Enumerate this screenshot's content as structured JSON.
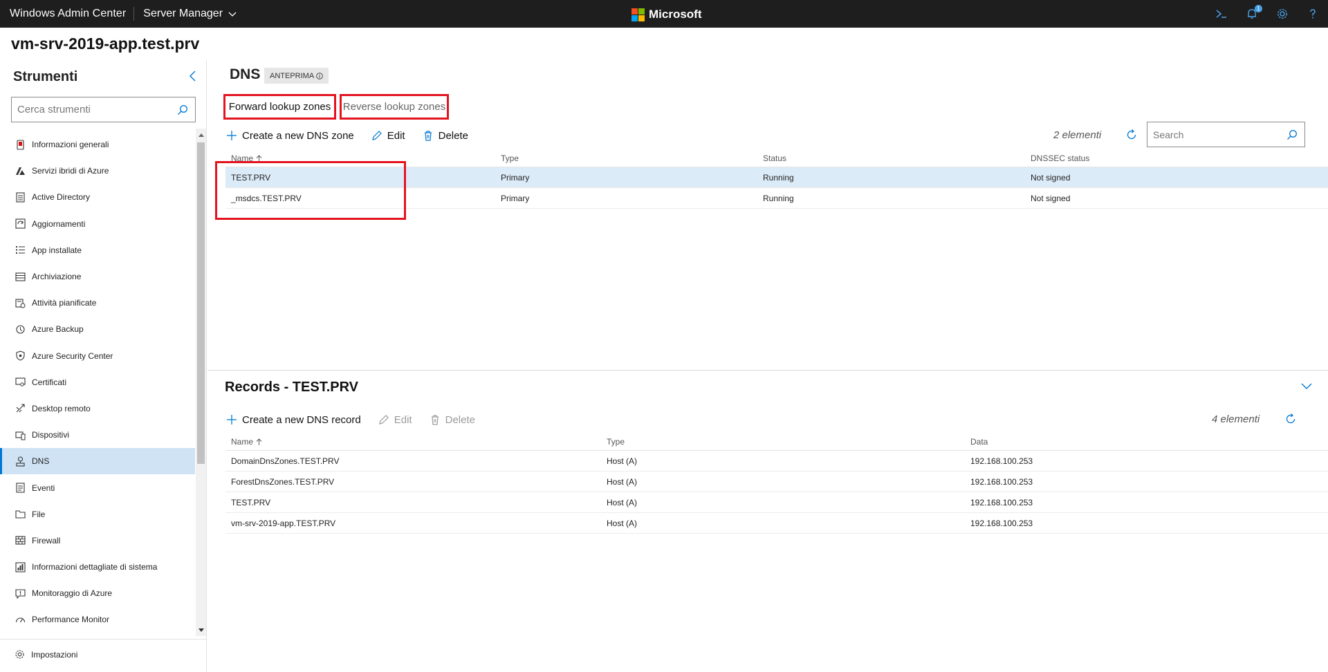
{
  "app": {
    "brand": "Windows Admin Center",
    "context": "Server Manager",
    "ms_logo_text": "Microsoft",
    "ms_colors": [
      "#f25022",
      "#7fba00",
      "#00a4ef",
      "#ffb900"
    ],
    "notification_count": "1",
    "top_icons": [
      "powershell-icon",
      "notifications-icon",
      "settings-gear-icon",
      "help-icon"
    ]
  },
  "server": {
    "name": "vm-srv-2019-app.test.prv"
  },
  "sidebar": {
    "title": "Strumenti",
    "search_placeholder": "Cerca strumenti",
    "items": [
      {
        "label": "Informazioni generali",
        "icon": "overview-icon"
      },
      {
        "label": "Servizi ibridi di Azure",
        "icon": "azure-icon"
      },
      {
        "label": "Active Directory",
        "icon": "active-directory-icon"
      },
      {
        "label": "Aggiornamenti",
        "icon": "updates-icon"
      },
      {
        "label": "App installate",
        "icon": "installed-apps-icon"
      },
      {
        "label": "Archiviazione",
        "icon": "storage-icon"
      },
      {
        "label": "Attività pianificate",
        "icon": "scheduled-tasks-icon"
      },
      {
        "label": "Azure Backup",
        "icon": "azure-backup-icon"
      },
      {
        "label": "Azure Security Center",
        "icon": "security-center-icon"
      },
      {
        "label": "Certificati",
        "icon": "certificates-icon"
      },
      {
        "label": "Desktop remoto",
        "icon": "remote-desktop-icon"
      },
      {
        "label": "Dispositivi",
        "icon": "devices-icon"
      },
      {
        "label": "DNS",
        "icon": "dns-icon",
        "active": true
      },
      {
        "label": "Eventi",
        "icon": "events-icon"
      },
      {
        "label": "File",
        "icon": "files-icon"
      },
      {
        "label": "Firewall",
        "icon": "firewall-icon"
      },
      {
        "label": "Informazioni dettagliate di sistema",
        "icon": "system-insights-icon"
      },
      {
        "label": "Monitoraggio di Azure",
        "icon": "azure-monitor-icon"
      },
      {
        "label": "Performance Monitor",
        "icon": "performance-monitor-icon"
      }
    ],
    "settings_label": "Impostazioni"
  },
  "dns": {
    "title": "DNS",
    "preview_badge": "ANTEPRIMA",
    "tabs": {
      "forward": "Forward lookup zones",
      "reverse": "Reverse lookup zones"
    },
    "toolbar": {
      "create": "Create a new DNS zone",
      "edit": "Edit",
      "delete": "Delete"
    },
    "count": "2 elementi",
    "search_placeholder": "Search",
    "columns": {
      "name": "Name",
      "type": "Type",
      "status": "Status",
      "dnssec": "DNSSEC status"
    },
    "zones": [
      {
        "name": "TEST.PRV",
        "type": "Primary",
        "status": "Running",
        "dnssec": "Not signed",
        "selected": true
      },
      {
        "name": "_msdcs.TEST.PRV",
        "type": "Primary",
        "status": "Running",
        "dnssec": "Not signed",
        "selected": false
      }
    ]
  },
  "records": {
    "title": "Records - TEST.PRV",
    "toolbar": {
      "create": "Create a new DNS record",
      "edit": "Edit",
      "delete": "Delete"
    },
    "count": "4 elementi",
    "columns": {
      "name": "Name",
      "type": "Type",
      "data": "Data"
    },
    "rows": [
      {
        "name": "DomainDnsZones.TEST.PRV",
        "type": "Host (A)",
        "data": "192.168.100.253"
      },
      {
        "name": "ForestDnsZones.TEST.PRV",
        "type": "Host (A)",
        "data": "192.168.100.253"
      },
      {
        "name": "TEST.PRV",
        "type": "Host (A)",
        "data": "192.168.100.253"
      },
      {
        "name": "vm-srv-2019-app.TEST.PRV",
        "type": "Host (A)",
        "data": "192.168.100.253"
      }
    ]
  },
  "colors": {
    "accent": "#0078d4",
    "highlight_red": "#e3131f",
    "topbar": "#1e1e1e",
    "selected_row": "#dcebf8"
  }
}
